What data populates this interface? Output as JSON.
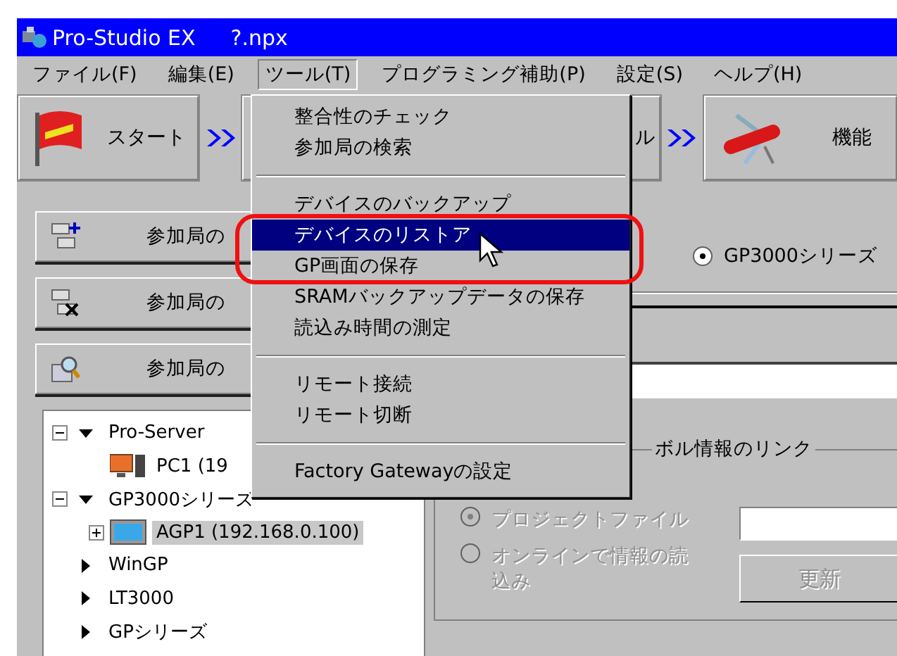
{
  "window": {
    "title": "Pro-Studio EX",
    "file": "?.npx"
  },
  "menu_bar": [
    {
      "label": "ファイル(F)",
      "selected": false
    },
    {
      "label": "編集(E)",
      "selected": false
    },
    {
      "label": "ツール(T)",
      "selected": true
    },
    {
      "label": "プログラミング補助(P)",
      "selected": false
    },
    {
      "label": "設定(S)",
      "selected": false
    },
    {
      "label": "ヘルプ(H)",
      "selected": false
    }
  ],
  "toolbar": [
    {
      "kind": "start",
      "label": "スタート"
    },
    {
      "kind": "plain",
      "label": "ル"
    },
    {
      "kind": "tools",
      "label": "機能"
    }
  ],
  "tools_menu": [
    {
      "kind": "item",
      "label": "整合性のチェック",
      "selected": false
    },
    {
      "kind": "item",
      "label": "参加局の検索",
      "selected": false
    },
    {
      "kind": "separator"
    },
    {
      "kind": "item",
      "label": "デバイスのバックアップ",
      "selected": false
    },
    {
      "kind": "item",
      "label": "デバイスのリストア",
      "selected": true
    },
    {
      "kind": "item",
      "label": "GP画面の保存",
      "selected": false
    },
    {
      "kind": "item",
      "label": "SRAMバックアップデータの保存",
      "selected": false
    },
    {
      "kind": "item",
      "label": "読込み時間の測定",
      "selected": false
    },
    {
      "kind": "separator"
    },
    {
      "kind": "item",
      "label": "リモート接続",
      "selected": false
    },
    {
      "kind": "item",
      "label": "リモート切断",
      "selected": false
    },
    {
      "kind": "separator"
    },
    {
      "kind": "item",
      "label": "Factory Gatewayの設定",
      "selected": false
    }
  ],
  "station_buttons": [
    {
      "kind": "add",
      "label": "参加局の"
    },
    {
      "kind": "delete",
      "label": "参加局の"
    },
    {
      "kind": "search",
      "label": "参加局の"
    }
  ],
  "tree": [
    {
      "kind": "series",
      "label": "Pro-Server",
      "expanded": true,
      "selected": false,
      "children": [
        {
          "kind": "pc",
          "label": "PC1 (19",
          "selected": false
        }
      ]
    },
    {
      "kind": "series",
      "label": "GP3000シリーズ",
      "expanded": true,
      "selected": false,
      "children": [
        {
          "kind": "panel",
          "label": "AGP1 (192.168.0.100)",
          "expanded": false,
          "selected": true
        }
      ]
    },
    {
      "kind": "series",
      "label": "WinGP",
      "expanded": false,
      "selected": false
    },
    {
      "kind": "series",
      "label": "LT3000",
      "expanded": false,
      "selected": false
    },
    {
      "kind": "series",
      "label": "GPシリーズ",
      "expanded": false,
      "selected": false
    }
  ],
  "series_option": {
    "label": "GP3000シリーズ",
    "selected": true
  },
  "symbol_link": {
    "title": "ボル情報のリンク",
    "options": [
      {
        "label": "プロジェクトファイル",
        "selected": true,
        "disabled": true
      },
      {
        "label": "オンラインで情報の読込み",
        "selected": false,
        "disabled": true
      }
    ],
    "update_button": {
      "label": "更新",
      "disabled": true
    }
  }
}
